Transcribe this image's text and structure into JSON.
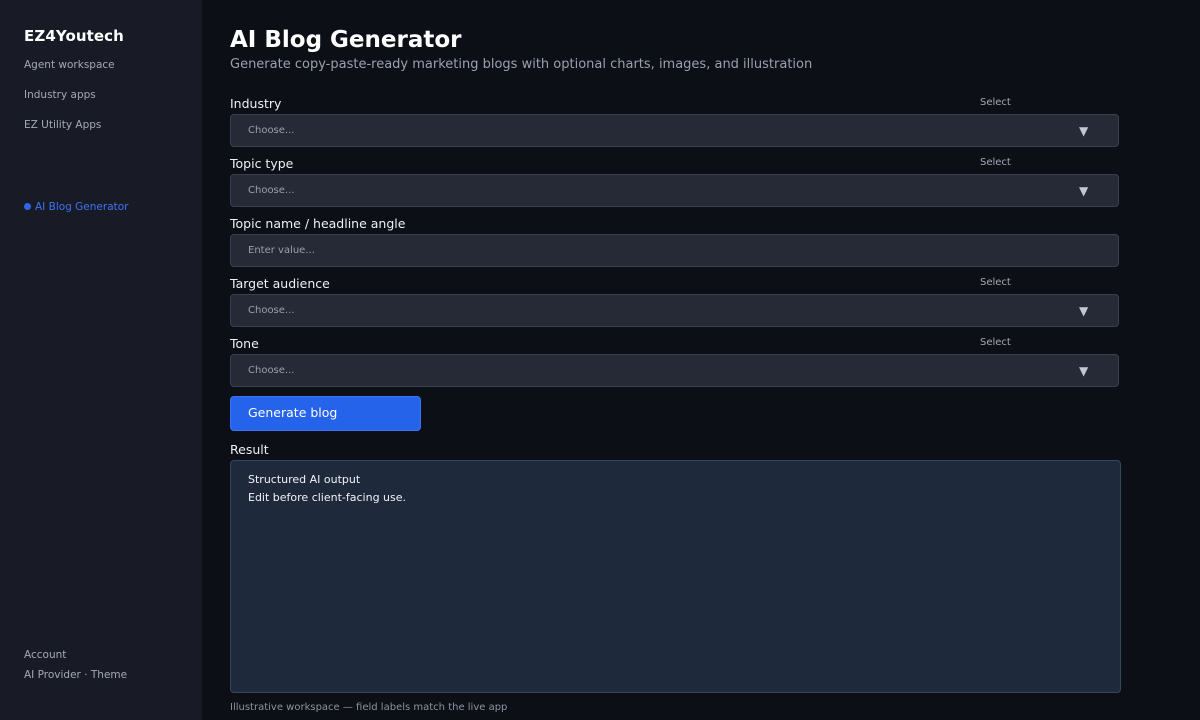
{
  "sidebar": {
    "brand": "EZ4Youtech",
    "nav": [
      {
        "label": "Agent workspace"
      },
      {
        "label": "Industry apps"
      },
      {
        "label": "EZ Utility Apps"
      }
    ],
    "active_item": "AI Blog Generator",
    "account": "Account",
    "ai_provider": "AI Provider",
    "separator": "·",
    "theme": "Theme"
  },
  "main": {
    "title": "AI Blog Generator",
    "subtitle": "Generate copy-paste-ready marketing blogs with optional charts, images, and illustration",
    "fields": [
      {
        "label": "Industry",
        "hint": "Select",
        "placeholder": "Choose...",
        "kind": "select"
      },
      {
        "label": "Topic type",
        "hint": "Select",
        "placeholder": "Choose...",
        "kind": "select"
      },
      {
        "label": "Topic name / headline angle",
        "placeholder": "Enter value...",
        "kind": "text"
      },
      {
        "label": "Target audience",
        "hint": "Select",
        "placeholder": "Choose...",
        "kind": "select"
      },
      {
        "label": "Tone",
        "hint": "Select",
        "placeholder": "Choose...",
        "kind": "select"
      }
    ],
    "chevron": "▼",
    "generate_button": "Generate blog",
    "result_label": "Result",
    "result_lines": [
      "Structured AI output",
      "Edit before client-facing use."
    ],
    "footnote": "Illustrative workspace — field labels match the live app"
  },
  "colors": {
    "accent": "#2563eb",
    "active_nav": "#3b74f2",
    "sidebar_bg": "#181b26",
    "page_bg": "#0c0f16",
    "input_bg": "#262a37",
    "result_bg": "#1e293b"
  }
}
